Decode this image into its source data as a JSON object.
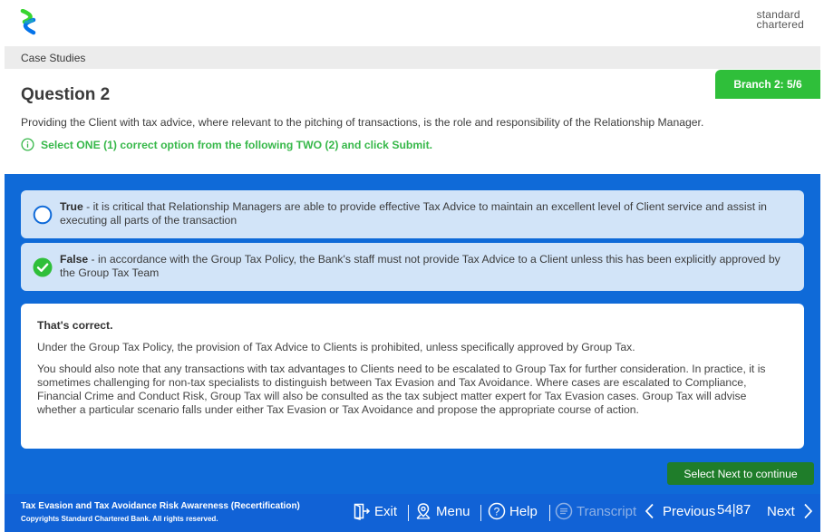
{
  "brand": {
    "name_line1": "standard",
    "name_line2": "chartered",
    "colors": {
      "blue": "#0f6ad8",
      "green": "#2fbf3a",
      "logo_green": "#38d430",
      "logo_blue": "#0473ea"
    }
  },
  "breadcrumb": "Case Studies",
  "branch_badge": "Branch 2: 5/6",
  "question": {
    "title": "Question 2",
    "text": "Providing the Client with tax advice, where relevant to the pitching of transactions, is the role and responsibility of the Relationship Manager.",
    "instruction": "Select ONE (1) correct option from the following TWO (2) and click Submit."
  },
  "options": [
    {
      "label": "True",
      "text": " - it is critical that Relationship Managers are able to provide effective Tax Advice to maintain an excellent level of Client service and assist in executing all parts of the transaction",
      "selected": false
    },
    {
      "label": "False",
      "text": " - in accordance with the Group Tax Policy, the Bank's staff must not provide Tax Advice to a Client unless this has been explicitly approved by the Group Tax Team",
      "selected": true
    }
  ],
  "feedback": {
    "title": "That's correct.",
    "paragraph1": "Under the Group Tax Policy, the provision of Tax Advice to Clients is prohibited, unless specifically approved by Group Tax.",
    "paragraph2": "You should also note that any transactions with tax advantages to Clients need to be escalated to Group Tax for further consideration. In practice, it is sometimes challenging for non-tax specialists to distinguish between Tax Evasion and Tax Avoidance. Where cases are escalated to Compliance, Financial Crime and Conduct Risk, Group Tax will also be consulted as the tax subject matter expert for Tax Evasion cases. Group Tax will advise whether a particular scenario falls under either Tax Evasion or Tax Avoidance and propose the appropriate course of action."
  },
  "next_tip": "Select Next to continue",
  "footer": {
    "course_title": "Tax Evasion and Tax Avoidance Risk Awareness (Recertification)",
    "copyright": "Copyrights Standard Chartered Bank. All rights reserved.",
    "exit": "Exit",
    "menu": "Menu",
    "help": "Help",
    "transcript": "Transcript",
    "previous": "Previous",
    "page_current": "54",
    "page_total": "87",
    "next": "Next"
  }
}
